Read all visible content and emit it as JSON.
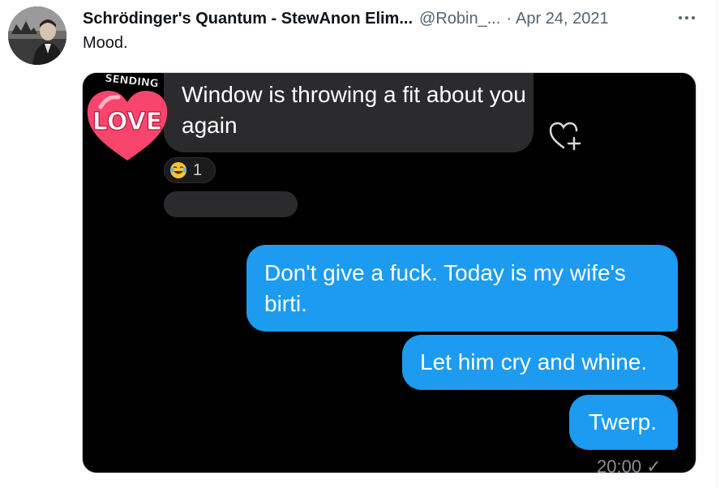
{
  "tweet": {
    "author_name": "Schrödinger's Quantum - StewAnon Elim...",
    "handle": "@Robin_...",
    "separator": "·",
    "date": "Apr 24, 2021",
    "text": "Mood."
  },
  "chat": {
    "incoming_message": "Window is throwing a fit about you again",
    "sticker_top_text": "SENDING",
    "sticker_main_text": "LOVE",
    "reaction_count": "1",
    "outgoing_messages": [
      {
        "text": "Don't give a fuck. Today is my wife's birti."
      },
      {
        "text": "Let him cry and whine."
      },
      {
        "text": "Twerp."
      }
    ],
    "timestamp": "20:00 ✓"
  },
  "colors": {
    "outgoing_bubble": "#1c9bf0",
    "incoming_bubble": "#2b2b2d",
    "chat_background": "#000000",
    "secondary_text": "#536471"
  },
  "icons": [
    "more-icon",
    "sticker-heart-icon",
    "laughing-emoji-icon",
    "heart-add-icon"
  ]
}
